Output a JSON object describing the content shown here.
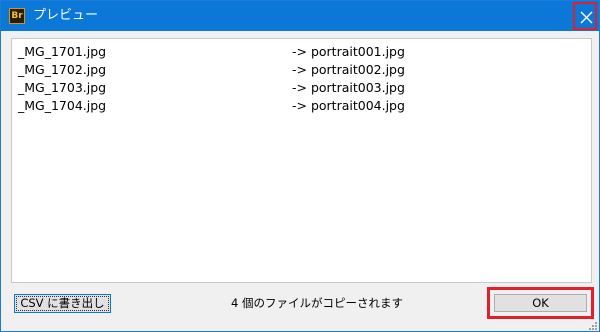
{
  "window": {
    "title": "プレビュー",
    "app_icon_text": "Br",
    "close_icon": "close-icon"
  },
  "list": {
    "rows": [
      {
        "source": "_MG_1701.jpg",
        "target": "->  portrait001.jpg"
      },
      {
        "source": "_MG_1702.jpg",
        "target": "->  portrait002.jpg"
      },
      {
        "source": "_MG_1703.jpg",
        "target": "->  portrait003.jpg"
      },
      {
        "source": "_MG_1704.jpg",
        "target": "->  portrait004.jpg"
      }
    ]
  },
  "footer": {
    "csv_button_label": "CSV に書き出し",
    "status_text": "4 個のファイルがコピーされます",
    "ok_button_label": "OK"
  },
  "colors": {
    "titlebar": "#0b78d7",
    "highlight": "#e0202a"
  }
}
